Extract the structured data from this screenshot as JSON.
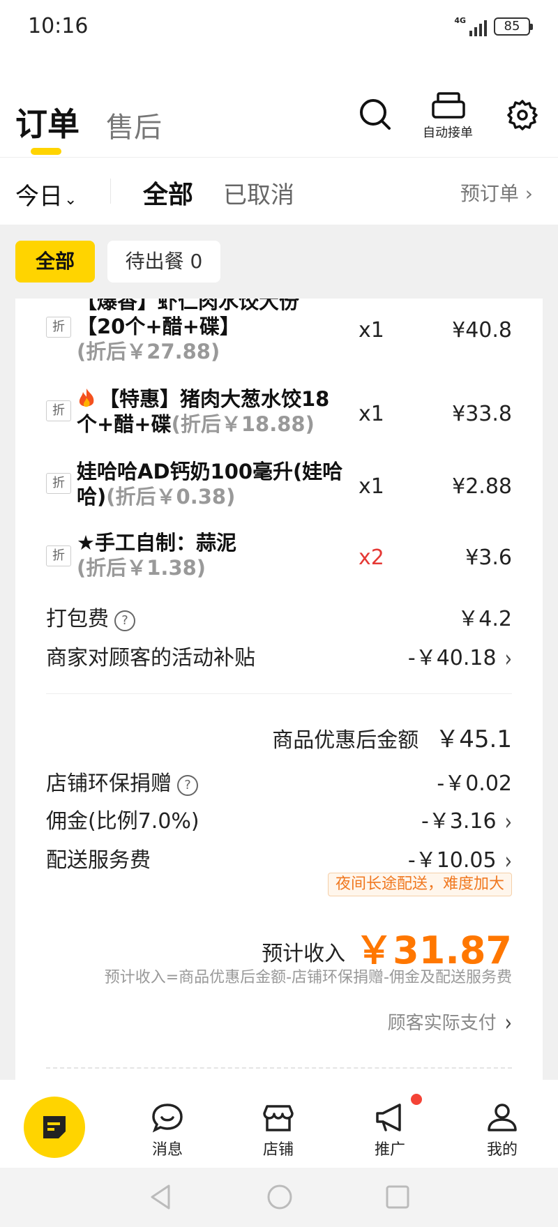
{
  "status_bar": {
    "time": "10:16",
    "network": "4G",
    "battery": "85"
  },
  "header": {
    "tab_orders": "订单",
    "tab_aftersale": "售后",
    "auto_accept_label": "自动接单",
    "icons": [
      "search-icon",
      "printer-icon",
      "settings-icon"
    ]
  },
  "filters": {
    "date": "今日",
    "tab_all": "全部",
    "tab_cancelled": "已取消",
    "preorder": "预订单"
  },
  "chips": {
    "all": "全部",
    "waiting": "待出餐 0"
  },
  "items": [
    {
      "tag": "折",
      "name_line1": "【爆香】虾仁肉水饺大份",
      "name_line2": "【20个+醋+碟】",
      "discount": "(折后￥27.88)",
      "qty": "x1",
      "price": "¥40.8"
    },
    {
      "tag": "折",
      "name_line1": "【特惠】猪肉大葱水饺18",
      "name_line2": "个+醋+碟",
      "discount": "(折后￥18.88)",
      "qty": "x1",
      "price": "¥33.8"
    },
    {
      "tag": "折",
      "name_line1": "娃哈哈AD钙奶100毫升(娃哈",
      "name_line2": "哈)",
      "discount": "(折后￥0.38)",
      "qty": "x1",
      "price": "¥2.88"
    },
    {
      "tag": "折",
      "name_line1": "★手工自制：蒜泥",
      "name_line2": "",
      "discount": "(折后￥1.38)",
      "qty": "x2",
      "price": "¥3.6"
    }
  ],
  "fees": {
    "packing_label": "打包费",
    "packing_value": "￥4.2",
    "subsidy_label": "商家对顾客的活动补贴",
    "subsidy_value": "-￥40.18",
    "subtotal_label": "商品优惠后金额",
    "subtotal_value": "￥45.1",
    "eco_label": "店铺环保捐赠",
    "eco_value": "-￥0.02",
    "commission_label": "佣金(比例7.0%)",
    "commission_value": "-￥3.16",
    "delivery_label": "配送服务费",
    "delivery_value": "-￥10.05",
    "delivery_badge": "夜间长途配送，难度加大"
  },
  "income": {
    "label": "预计收入",
    "value": "￥31.87",
    "formula": "预计收入=商品优惠后金额-店铺环保捐赠-佣金及配送服务费",
    "paid_link": "顾客实际支付"
  },
  "tabbar": {
    "messages": "消息",
    "store": "店铺",
    "promo": "推广",
    "mine": "我的"
  },
  "colors": {
    "accent": "#ffd400",
    "income": "#ff7700",
    "alert": "#e53935"
  }
}
